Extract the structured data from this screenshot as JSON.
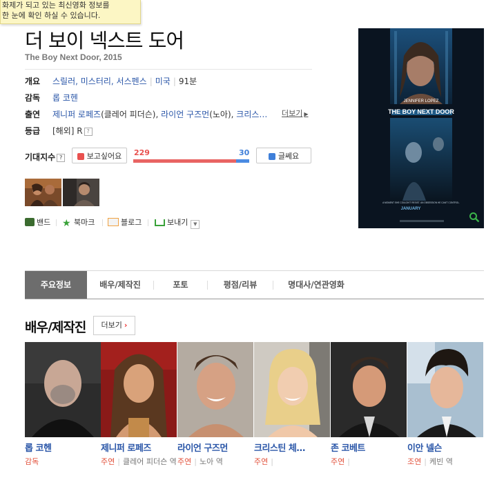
{
  "notice": {
    "line1": "화제가 되고 있는 최신영화 정보를",
    "line2": "한 눈에 확인 하실 수 있습니다."
  },
  "movie": {
    "title": "더 보이 넥스트 도어",
    "subtitle": "The Boy Next Door, 2015"
  },
  "info": {
    "overview_label": "개요",
    "genre": "스릴러, 미스터리, 서스펜스",
    "country": "미국",
    "runtime": "91분",
    "director_label": "감독",
    "director": "롭 코헨",
    "cast_label": "출연",
    "cast_1_name": "제니퍼 로페즈",
    "cast_1_role": "(클레어 피더슨),",
    "cast_2_name": "라이언 구즈먼",
    "cast_2_role": "(노아),",
    "cast_3_name": "크리스…",
    "more_label": "더보기",
    "rating_label": "등급",
    "rating_value": "[해외] R"
  },
  "expectation": {
    "label": "기대지수",
    "want_label": "보고싶어요",
    "want_count": "229",
    "nowant_count": "30",
    "nowant_label": "글쎄요",
    "want_ratio": 0.884,
    "want_color": "#e96463",
    "nowant_color": "#4a8be2"
  },
  "share": {
    "band": "밴드",
    "bookmark": "북마크",
    "blog": "블로그",
    "send": "보내기"
  },
  "tabs": [
    {
      "label": "주요정보"
    },
    {
      "label": "배우/제작진"
    },
    {
      "label": "포토"
    },
    {
      "label": "평점/리뷰"
    },
    {
      "label": "명대사/연관영화"
    }
  ],
  "cast_section": {
    "title": "배우/제작진",
    "more_label": "더보기"
  },
  "cast": [
    {
      "name": "롭 코헨",
      "type": "감독",
      "role": ""
    },
    {
      "name": "제니퍼 로페즈",
      "type": "주연",
      "role": "클레어 피더슨 역"
    },
    {
      "name": "라이언 구즈먼",
      "type": "주연",
      "role": "노아 역"
    },
    {
      "name": "크리스틴 체…",
      "type": "주연",
      "role": ""
    },
    {
      "name": "존 코베트",
      "type": "주연",
      "role": ""
    },
    {
      "name": "이안 넬슨",
      "type": "조연",
      "role": "케빈 역"
    }
  ],
  "poster": {
    "actor_credit": "JENNIFER LOPEZ",
    "title": "THE BOY NEXT DOOR",
    "tagline": "A MOMENT SHE COULDN'T RESIST. AN OBSESSION HE CAN'T CONTROL.",
    "release": "JANUARY"
  }
}
